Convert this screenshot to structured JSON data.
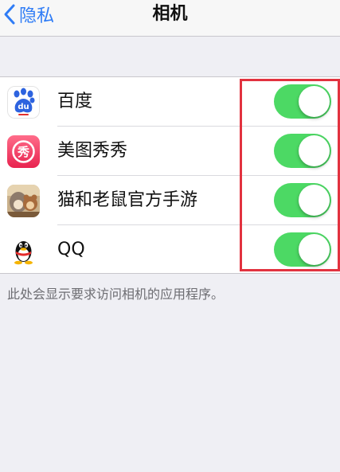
{
  "navbar": {
    "back_label": "隐私",
    "title": "相机"
  },
  "apps": [
    {
      "name": "百度",
      "icon": "baidu-app-icon",
      "enabled": true
    },
    {
      "name": "美图秀秀",
      "icon": "meitu-app-icon",
      "enabled": true
    },
    {
      "name": "猫和老鼠官方手游",
      "icon": "tom-and-jerry-game-icon",
      "enabled": true
    },
    {
      "name": "QQ",
      "icon": "qq-penguin-icon",
      "enabled": true
    }
  ],
  "footer": {
    "note": "此处会显示要求访问相机的应用程序。"
  },
  "colors": {
    "accent": "#2f7cf6",
    "toggle_on": "#4cd964",
    "highlight_border": "#e2323f"
  }
}
